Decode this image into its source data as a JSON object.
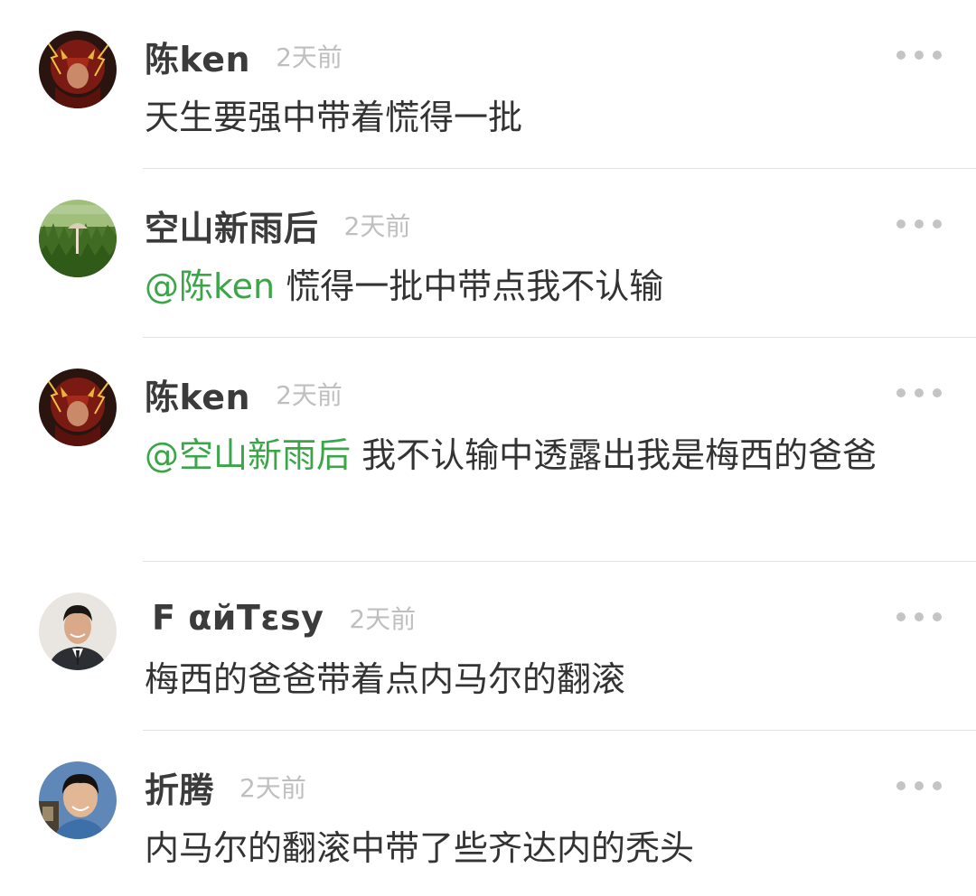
{
  "comments": [
    {
      "username": "陈ken",
      "time": "2天前",
      "mention": "",
      "text": "天生要强中带着慌得一批",
      "more_label": "•••"
    },
    {
      "username": "空山新雨后",
      "time": "2天前",
      "mention": "@陈ken",
      "text": " 慌得一批中带点我不认输",
      "more_label": "•••"
    },
    {
      "username": "陈ken",
      "time": "2天前",
      "mention": "@空山新雨后",
      "text": " 我不认输中透露出我是梅西的爸爸",
      "more_label": "•••"
    },
    {
      "username": "F αйTεsy",
      "time": "2天前",
      "mention": "",
      "text": "梅西的爸爸带着点内马尔的翻滚",
      "more_label": "•••"
    },
    {
      "username": "折腾",
      "time": "2天前",
      "mention": "",
      "text": "内马尔的翻滚中带了些齐达内的秃头",
      "more_label": "•••"
    }
  ],
  "colors": {
    "mention": "#3aa648",
    "timestamp": "#bfbfbf",
    "divider": "#e2e2e2"
  },
  "icons": [
    "avatar-flash-hero-icon",
    "avatar-grass-mushroom-icon",
    "avatar-man-suit-icon",
    "avatar-boy-photo-icon",
    "more-options-icon"
  ]
}
